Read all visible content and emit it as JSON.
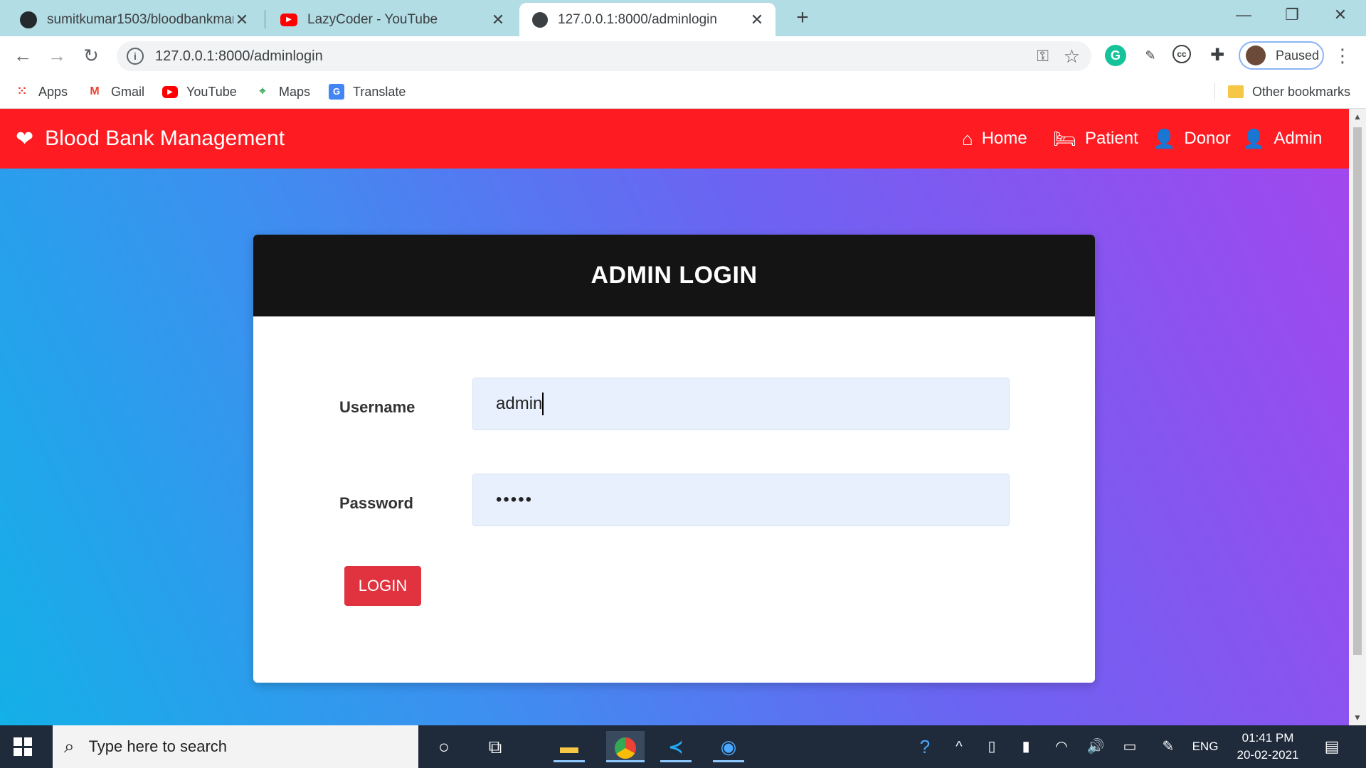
{
  "browser": {
    "tabs": [
      {
        "title": "sumitkumar1503/bloodbankman",
        "icon": "github-icon"
      },
      {
        "title": "LazyCoder - YouTube",
        "icon": "youtube-icon"
      },
      {
        "title": "127.0.0.1:8000/adminlogin",
        "icon": "globe-icon"
      }
    ],
    "active_tab": 2,
    "url": "127.0.0.1:8000/adminlogin",
    "profile_status": "Paused",
    "bookmarks": [
      {
        "label": "Apps",
        "icon": "apps-grid-icon"
      },
      {
        "label": "Gmail",
        "icon": "gmail-icon"
      },
      {
        "label": "YouTube",
        "icon": "youtube-icon"
      },
      {
        "label": "Maps",
        "icon": "maps-icon"
      },
      {
        "label": "Translate",
        "icon": "translate-icon"
      }
    ],
    "other_bookmarks": "Other bookmarks"
  },
  "app": {
    "brand": "Blood Bank Management",
    "nav": [
      {
        "label": "Home",
        "icon": "home-icon"
      },
      {
        "label": "Patient",
        "icon": "bed-icon"
      },
      {
        "label": "Donor",
        "icon": "user-icon"
      },
      {
        "label": "Admin",
        "icon": "user-cog-icon"
      }
    ],
    "colors": {
      "navbar": "#fe1b22",
      "card_header": "#141414",
      "login_button": "#e0333f"
    }
  },
  "login": {
    "title": "ADMIN LOGIN",
    "username_label": "Username",
    "username_value": "admin",
    "password_label": "Password",
    "password_value": "•••••",
    "button_label": "LOGIN"
  },
  "taskbar": {
    "search_placeholder": "Type here to search",
    "language": "ENG",
    "time": "01:41 PM",
    "date": "20-02-2021"
  }
}
